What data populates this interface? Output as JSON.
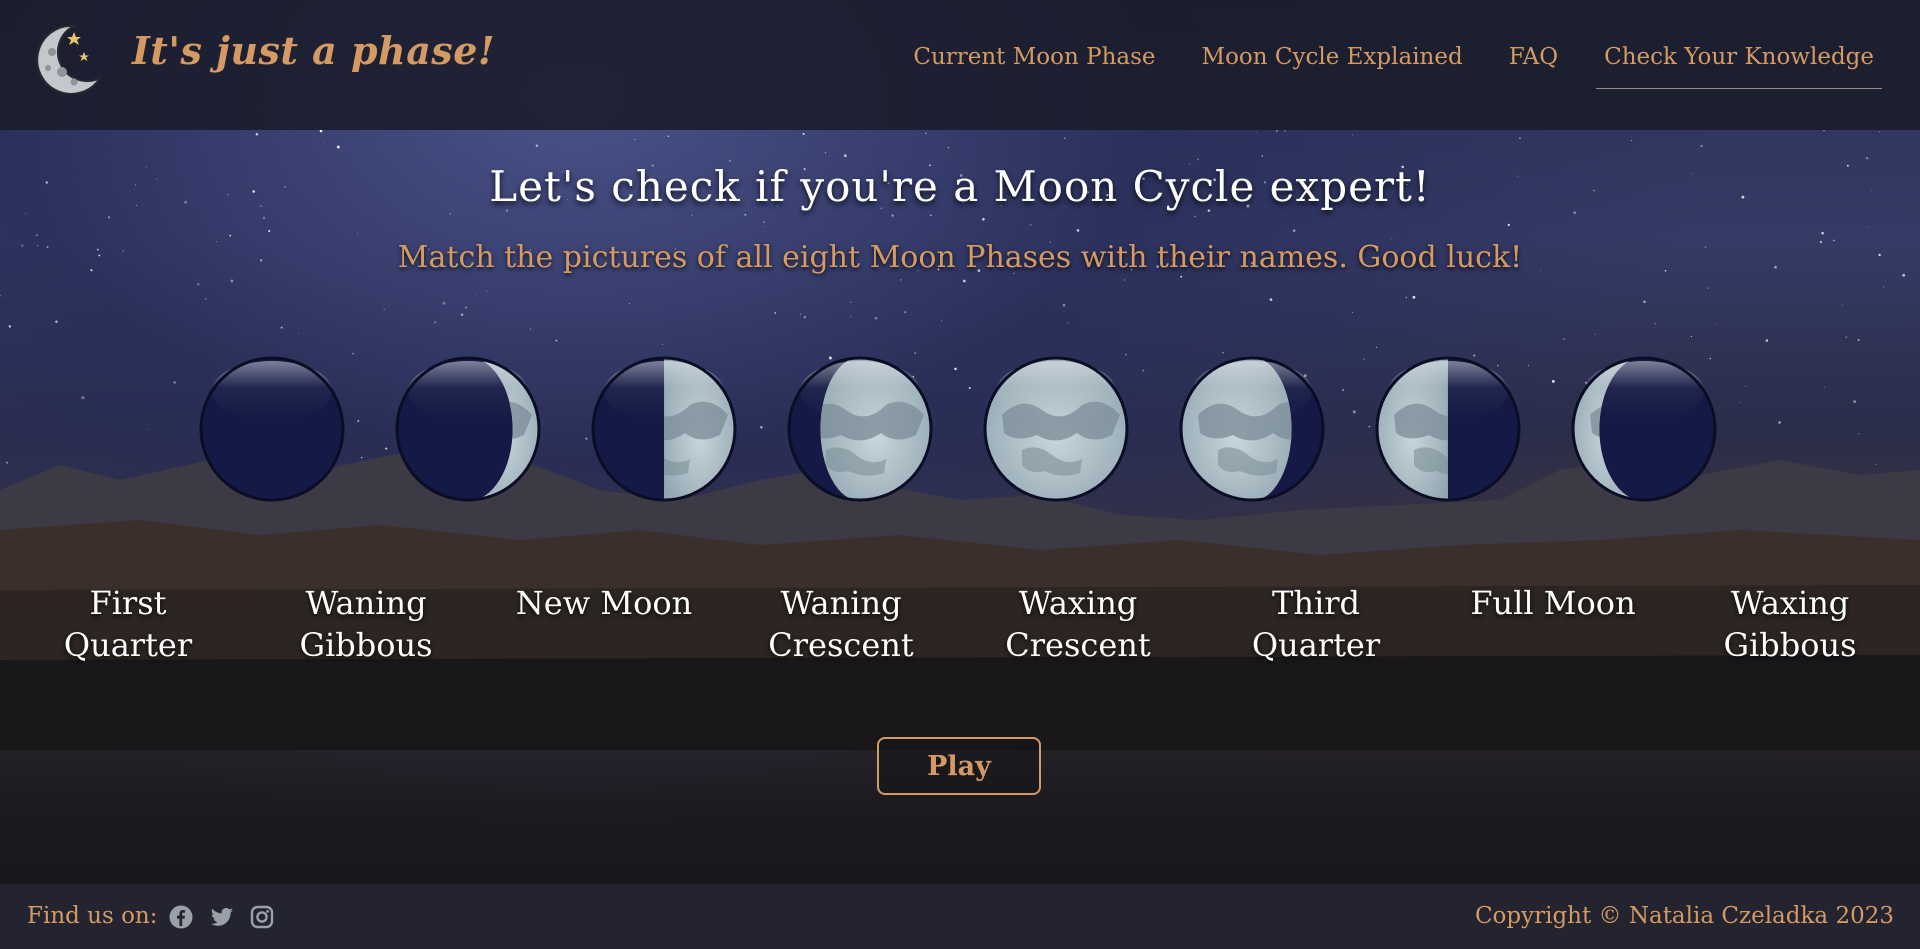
{
  "brand": {
    "name": "It's just a phase!"
  },
  "nav": {
    "items": [
      {
        "label": "Current Moon Phase"
      },
      {
        "label": "Moon Cycle Explained"
      },
      {
        "label": "FAQ"
      },
      {
        "label": "Check Your Knowledge"
      }
    ],
    "active": "Check Your Knowledge"
  },
  "main": {
    "title": "Let's check if you're a Moon Cycle expert!",
    "subtitle": "Match the pictures of all eight Moon Phases with their names. Good luck!",
    "moons": [
      {
        "phase": "new"
      },
      {
        "phase": "waxing-crescent"
      },
      {
        "phase": "first-quarter"
      },
      {
        "phase": "waxing-gibbous"
      },
      {
        "phase": "full"
      },
      {
        "phase": "waning-gibbous"
      },
      {
        "phase": "third-quarter"
      },
      {
        "phase": "waning-crescent"
      }
    ],
    "labels": [
      {
        "line1": "First",
        "line2": "Quarter"
      },
      {
        "line1": "Waning",
        "line2": "Gibbous"
      },
      {
        "line1": "New Moon",
        "line2": ""
      },
      {
        "line1": "Waning",
        "line2": "Crescent"
      },
      {
        "line1": "Waxing",
        "line2": "Crescent"
      },
      {
        "line1": "Third",
        "line2": "Quarter"
      },
      {
        "line1": "Full Moon",
        "line2": ""
      },
      {
        "line1": "Waxing",
        "line2": "Gibbous"
      }
    ],
    "play_label": "Play"
  },
  "footer": {
    "find_us": "Find us on:",
    "social_icons": [
      "facebook-icon",
      "twitter-icon",
      "instagram-icon"
    ],
    "copyright": "Copyright © Natalia Czeladka 2023"
  },
  "colors": {
    "accent": "#d59a63",
    "header_bg": "#1a1c2a",
    "footer_bg": "#23242f",
    "moon_dark": "#141a45",
    "moon_light": "#b6c4cc"
  }
}
